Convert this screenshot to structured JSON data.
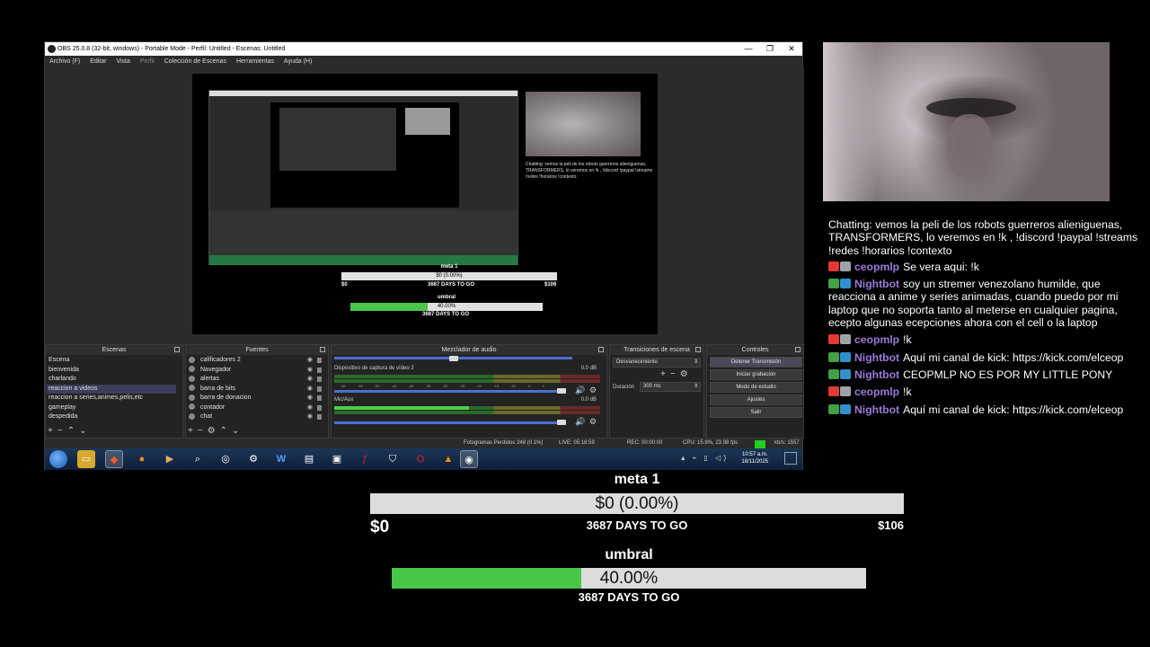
{
  "obs": {
    "title": "OBS 25.0.8 (32-bit, windows) - Portable Mode - Perfil: Untitled - Escenas: Untitled",
    "window_controls": [
      "—",
      "❐",
      "✕"
    ],
    "menu": [
      "Archivo (F)",
      "Editar",
      "Vista",
      "Perfil",
      "Colección de Escenas",
      "Herramientas",
      "Ayuda (H)"
    ],
    "docks": {
      "scenes": {
        "title": "Escenas",
        "items": [
          "Escena",
          "bienvenida",
          "charlando",
          "reaccion a videos",
          "reaccion a series,animes,pelis,etc",
          "gameplay",
          "despedida"
        ],
        "selected_index": 3
      },
      "sources": {
        "title": "Fuentes",
        "items": [
          "calificadores 2",
          "Navegador",
          "alertas",
          "barra de bits",
          "barra de donacion",
          "contador",
          "chat"
        ]
      },
      "mixer": {
        "title": "Mezclador de audio",
        "channels": [
          {
            "name": "Dispositivo de captura de vídeo 2",
            "db": "0.0 dB"
          },
          {
            "name": "Mic/Aux",
            "db": "0.0 dB"
          }
        ],
        "scale": [
          "-60",
          "-55",
          "-50",
          "-45",
          "-40",
          "-35",
          "-30",
          "-25",
          "-20",
          "-15",
          "-10",
          "-5",
          "0"
        ]
      },
      "transitions": {
        "title": "Transiciones de escena",
        "current": "Desvanecimiento",
        "duration_label": "Duración",
        "duration_value": "300 ms"
      },
      "controls": {
        "title": "Controles",
        "buttons": [
          "Detener Transmisión",
          "Iniciar grabación",
          "Modo de estudio",
          "Ajustes",
          "Salir"
        ]
      }
    },
    "status": {
      "dropped": "Fotogramas Perdidos 248 (0.1%)",
      "live": "LIVE: 05:18:59",
      "rec": "REC: 00:00:00",
      "cpu": "CPU: 15.9%, 23.98 fps",
      "kbps": "kb/s: 1557"
    },
    "taskbar": {
      "time": "10:57 a.m.",
      "date": "18/11/2025",
      "icons": [
        "folder-icon",
        "brave-icon",
        "firefox-icon",
        "media-icon",
        "search-icon",
        "app-icon",
        "gear-icon",
        "word-icon",
        "network-icon",
        "monitor-icon",
        "flash-icon",
        "shield-icon",
        "opera-icon",
        "vlc-icon",
        "obs-icon"
      ]
    }
  },
  "preview_goals": {
    "meta_title": "meta 1",
    "meta_value": "$0 (0.00%)",
    "meta_min": "$0",
    "meta_max": "$106",
    "meta_days": "3687 DAYS TO GO",
    "umbral_title": "umbral",
    "umbral_value": "40.00%",
    "umbral_days": "3687 DAYS TO GO"
  },
  "chat": {
    "topic": "Chatting: vemos la peli de los robots guerreros alieniguenas, TRANSFORMERS, lo veremos en !k , !discord !paypal !streams !redes !horarios !contexto",
    "messages": [
      {
        "badges": [
          "red",
          "gray"
        ],
        "user": "ceopmlp",
        "text": "Se vera aqui: !k"
      },
      {
        "badges": [
          "green",
          "blue"
        ],
        "user": "Nightbot",
        "text": "soy un stremer venezolano humilde, que reacciona a anime y series animadas, cuando puedo por mi laptop que no soporta tanto al meterse en cualquier pagina, ecepto algunas ecepciones ahora con el cell o la laptop"
      },
      {
        "badges": [
          "red",
          "gray"
        ],
        "user": "ceopmlp",
        "text": "!k"
      },
      {
        "badges": [
          "green",
          "blue"
        ],
        "user": "Nightbot",
        "text": "Aquí mi canal de kick: https://kick.com/elceop"
      },
      {
        "badges": [
          "green",
          "blue"
        ],
        "user": "Nightbot",
        "text": "CEOPMLP NO ES POR MY LITTLE PONY"
      },
      {
        "badges": [
          "red",
          "gray"
        ],
        "user": "ceopmlp",
        "text": "!k"
      },
      {
        "badges": [
          "green",
          "blue"
        ],
        "user": "Nightbot",
        "text": "Aquí mi canal de kick: https://kick.com/elceop"
      }
    ]
  },
  "goals": {
    "meta": {
      "title": "meta 1",
      "value_text": "$0 (0.00%)",
      "progress": 0.0,
      "min": "$0",
      "days": "3687 DAYS TO GO",
      "max": "$106"
    },
    "umbral": {
      "title": "umbral",
      "value_text": "40.00%",
      "progress": 0.4,
      "days": "3687 DAYS TO GO"
    }
  },
  "colors": {
    "goal_fill": "#47c647",
    "username": "#9b7ad8",
    "live_indicator": "#22d022"
  }
}
